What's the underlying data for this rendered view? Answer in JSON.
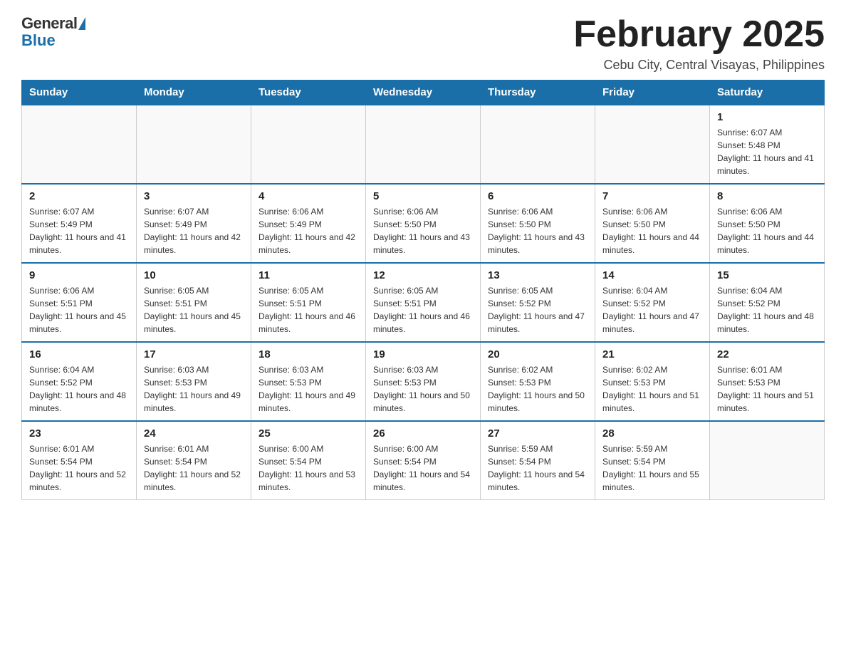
{
  "header": {
    "logo_general": "General",
    "logo_blue": "Blue",
    "month_title": "February 2025",
    "location": "Cebu City, Central Visayas, Philippines"
  },
  "days_of_week": [
    "Sunday",
    "Monday",
    "Tuesday",
    "Wednesday",
    "Thursday",
    "Friday",
    "Saturday"
  ],
  "weeks": [
    {
      "days": [
        {
          "date": "",
          "sunrise": "",
          "sunset": "",
          "daylight": ""
        },
        {
          "date": "",
          "sunrise": "",
          "sunset": "",
          "daylight": ""
        },
        {
          "date": "",
          "sunrise": "",
          "sunset": "",
          "daylight": ""
        },
        {
          "date": "",
          "sunrise": "",
          "sunset": "",
          "daylight": ""
        },
        {
          "date": "",
          "sunrise": "",
          "sunset": "",
          "daylight": ""
        },
        {
          "date": "",
          "sunrise": "",
          "sunset": "",
          "daylight": ""
        },
        {
          "date": "1",
          "sunrise": "Sunrise: 6:07 AM",
          "sunset": "Sunset: 5:48 PM",
          "daylight": "Daylight: 11 hours and 41 minutes."
        }
      ]
    },
    {
      "days": [
        {
          "date": "2",
          "sunrise": "Sunrise: 6:07 AM",
          "sunset": "Sunset: 5:49 PM",
          "daylight": "Daylight: 11 hours and 41 minutes."
        },
        {
          "date": "3",
          "sunrise": "Sunrise: 6:07 AM",
          "sunset": "Sunset: 5:49 PM",
          "daylight": "Daylight: 11 hours and 42 minutes."
        },
        {
          "date": "4",
          "sunrise": "Sunrise: 6:06 AM",
          "sunset": "Sunset: 5:49 PM",
          "daylight": "Daylight: 11 hours and 42 minutes."
        },
        {
          "date": "5",
          "sunrise": "Sunrise: 6:06 AM",
          "sunset": "Sunset: 5:50 PM",
          "daylight": "Daylight: 11 hours and 43 minutes."
        },
        {
          "date": "6",
          "sunrise": "Sunrise: 6:06 AM",
          "sunset": "Sunset: 5:50 PM",
          "daylight": "Daylight: 11 hours and 43 minutes."
        },
        {
          "date": "7",
          "sunrise": "Sunrise: 6:06 AM",
          "sunset": "Sunset: 5:50 PM",
          "daylight": "Daylight: 11 hours and 44 minutes."
        },
        {
          "date": "8",
          "sunrise": "Sunrise: 6:06 AM",
          "sunset": "Sunset: 5:50 PM",
          "daylight": "Daylight: 11 hours and 44 minutes."
        }
      ]
    },
    {
      "days": [
        {
          "date": "9",
          "sunrise": "Sunrise: 6:06 AM",
          "sunset": "Sunset: 5:51 PM",
          "daylight": "Daylight: 11 hours and 45 minutes."
        },
        {
          "date": "10",
          "sunrise": "Sunrise: 6:05 AM",
          "sunset": "Sunset: 5:51 PM",
          "daylight": "Daylight: 11 hours and 45 minutes."
        },
        {
          "date": "11",
          "sunrise": "Sunrise: 6:05 AM",
          "sunset": "Sunset: 5:51 PM",
          "daylight": "Daylight: 11 hours and 46 minutes."
        },
        {
          "date": "12",
          "sunrise": "Sunrise: 6:05 AM",
          "sunset": "Sunset: 5:51 PM",
          "daylight": "Daylight: 11 hours and 46 minutes."
        },
        {
          "date": "13",
          "sunrise": "Sunrise: 6:05 AM",
          "sunset": "Sunset: 5:52 PM",
          "daylight": "Daylight: 11 hours and 47 minutes."
        },
        {
          "date": "14",
          "sunrise": "Sunrise: 6:04 AM",
          "sunset": "Sunset: 5:52 PM",
          "daylight": "Daylight: 11 hours and 47 minutes."
        },
        {
          "date": "15",
          "sunrise": "Sunrise: 6:04 AM",
          "sunset": "Sunset: 5:52 PM",
          "daylight": "Daylight: 11 hours and 48 minutes."
        }
      ]
    },
    {
      "days": [
        {
          "date": "16",
          "sunrise": "Sunrise: 6:04 AM",
          "sunset": "Sunset: 5:52 PM",
          "daylight": "Daylight: 11 hours and 48 minutes."
        },
        {
          "date": "17",
          "sunrise": "Sunrise: 6:03 AM",
          "sunset": "Sunset: 5:53 PM",
          "daylight": "Daylight: 11 hours and 49 minutes."
        },
        {
          "date": "18",
          "sunrise": "Sunrise: 6:03 AM",
          "sunset": "Sunset: 5:53 PM",
          "daylight": "Daylight: 11 hours and 49 minutes."
        },
        {
          "date": "19",
          "sunrise": "Sunrise: 6:03 AM",
          "sunset": "Sunset: 5:53 PM",
          "daylight": "Daylight: 11 hours and 50 minutes."
        },
        {
          "date": "20",
          "sunrise": "Sunrise: 6:02 AM",
          "sunset": "Sunset: 5:53 PM",
          "daylight": "Daylight: 11 hours and 50 minutes."
        },
        {
          "date": "21",
          "sunrise": "Sunrise: 6:02 AM",
          "sunset": "Sunset: 5:53 PM",
          "daylight": "Daylight: 11 hours and 51 minutes."
        },
        {
          "date": "22",
          "sunrise": "Sunrise: 6:01 AM",
          "sunset": "Sunset: 5:53 PM",
          "daylight": "Daylight: 11 hours and 51 minutes."
        }
      ]
    },
    {
      "days": [
        {
          "date": "23",
          "sunrise": "Sunrise: 6:01 AM",
          "sunset": "Sunset: 5:54 PM",
          "daylight": "Daylight: 11 hours and 52 minutes."
        },
        {
          "date": "24",
          "sunrise": "Sunrise: 6:01 AM",
          "sunset": "Sunset: 5:54 PM",
          "daylight": "Daylight: 11 hours and 52 minutes."
        },
        {
          "date": "25",
          "sunrise": "Sunrise: 6:00 AM",
          "sunset": "Sunset: 5:54 PM",
          "daylight": "Daylight: 11 hours and 53 minutes."
        },
        {
          "date": "26",
          "sunrise": "Sunrise: 6:00 AM",
          "sunset": "Sunset: 5:54 PM",
          "daylight": "Daylight: 11 hours and 54 minutes."
        },
        {
          "date": "27",
          "sunrise": "Sunrise: 5:59 AM",
          "sunset": "Sunset: 5:54 PM",
          "daylight": "Daylight: 11 hours and 54 minutes."
        },
        {
          "date": "28",
          "sunrise": "Sunrise: 5:59 AM",
          "sunset": "Sunset: 5:54 PM",
          "daylight": "Daylight: 11 hours and 55 minutes."
        },
        {
          "date": "",
          "sunrise": "",
          "sunset": "",
          "daylight": ""
        }
      ]
    }
  ]
}
